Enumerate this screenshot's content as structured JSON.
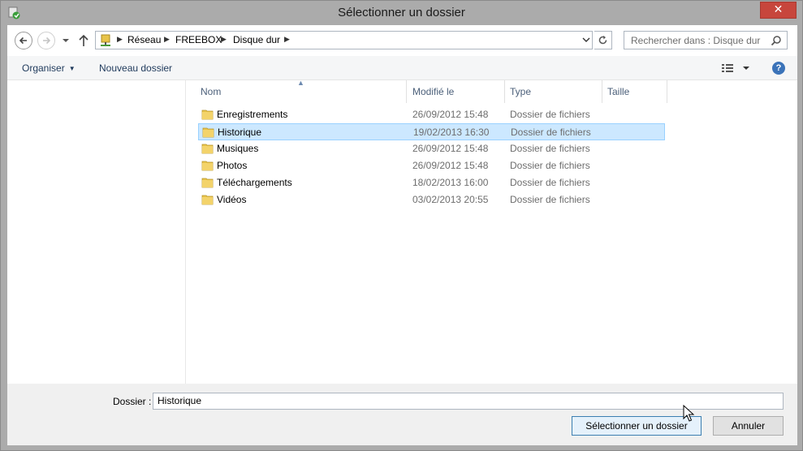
{
  "window": {
    "title": "Sélectionner un dossier",
    "close_label": "✕"
  },
  "address_bar": {
    "crumbs": [
      "Réseau",
      "FREEBOX",
      "Disque dur"
    ]
  },
  "search": {
    "placeholder": "Rechercher dans : Disque dur"
  },
  "commands": {
    "organize": "Organiser",
    "new_folder": "Nouveau dossier",
    "help": "?"
  },
  "columns": {
    "name": "Nom",
    "modified": "Modifié le",
    "type": "Type",
    "size": "Taille"
  },
  "files": [
    {
      "name": "Enregistrements",
      "modified": "26/09/2012 15:48",
      "type": "Dossier de fichiers",
      "selected": false
    },
    {
      "name": "Historique",
      "modified": "19/02/2013 16:30",
      "type": "Dossier de fichiers",
      "selected": true
    },
    {
      "name": "Musiques",
      "modified": "26/09/2012 15:48",
      "type": "Dossier de fichiers",
      "selected": false
    },
    {
      "name": "Photos",
      "modified": "26/09/2012 15:48",
      "type": "Dossier de fichiers",
      "selected": false
    },
    {
      "name": "Téléchargements",
      "modified": "18/02/2013 16:00",
      "type": "Dossier de fichiers",
      "selected": false
    },
    {
      "name": "Vidéos",
      "modified": "03/02/2013 20:55",
      "type": "Dossier de fichiers",
      "selected": false
    }
  ],
  "folder_field": {
    "label": "Dossier :",
    "value": "Historique"
  },
  "buttons": {
    "select": "Sélectionner un dossier",
    "cancel": "Annuler"
  },
  "colors": {
    "selection_bg": "#cce8ff",
    "selection_border": "#99d1ff",
    "close_red": "#c7463c",
    "link_blue": "#1e395b"
  },
  "icons": [
    "app-icon",
    "back-arrow-icon",
    "forward-arrow-icon",
    "chevron-down-icon",
    "up-arrow-icon",
    "network-drive-icon",
    "refresh-icon",
    "search-icon",
    "view-options-icon",
    "help-icon",
    "folder-icon",
    "mouse-cursor-icon"
  ]
}
